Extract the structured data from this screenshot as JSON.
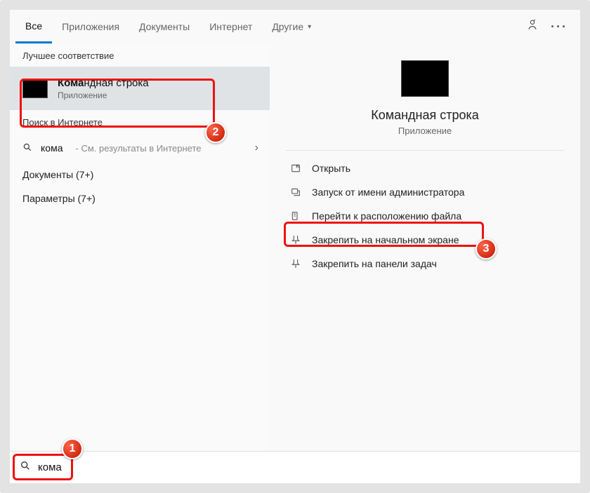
{
  "tabs": {
    "all": "Все",
    "apps": "Приложения",
    "docs": "Документы",
    "web": "Интернет",
    "more": "Другие"
  },
  "left": {
    "best_label": "Лучшее соответствие",
    "best_match": {
      "title_bold": "Кома",
      "title_rest": "ндная строка",
      "subtitle": "Приложение"
    },
    "web_label": "Поиск в Интернете",
    "web_row": {
      "query": "кома",
      "hint": "См. результаты в Интернете"
    },
    "docs_row": "Документы (7+)",
    "params_row": "Параметры (7+)"
  },
  "right": {
    "title": "Командная строка",
    "subtitle": "Приложение",
    "actions": {
      "open": "Открыть",
      "admin": "Запуск от имени администратора",
      "location": "Перейти к расположению файла",
      "pin_start": "Закрепить на начальном экране",
      "pin_task": "Закрепить на панели задач"
    }
  },
  "search": {
    "value": "кома"
  },
  "badges": {
    "b1": "1",
    "b2": "2",
    "b3": "3"
  }
}
